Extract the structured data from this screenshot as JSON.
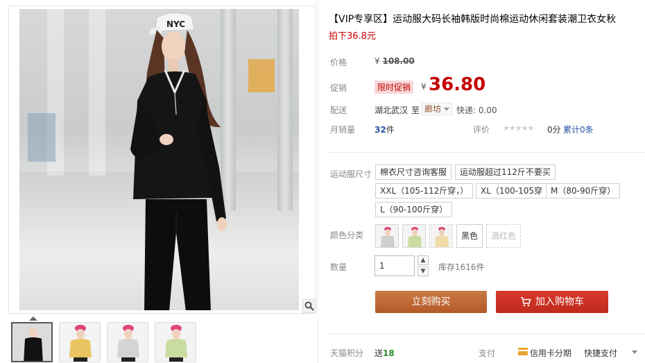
{
  "product": {
    "title": "【VIP专享区】运动服大码长袖韩版时尚棉运动休闲套装潮卫衣女秋",
    "subtitle": "拍下36.8元"
  },
  "price": {
    "label": "价格",
    "currency": "¥",
    "original": "108.00",
    "promo_label": "促销",
    "promo_tag": "限时促销",
    "promo_currency": "¥",
    "promo_value": "36.80"
  },
  "shipping": {
    "label": "配送",
    "from": "湖北武汉",
    "to_word": "至",
    "destination": "廊坊",
    "fee": "快递: 0.00"
  },
  "sales": {
    "label": "月销量",
    "count": "32",
    "unit": "件",
    "rating_label": "评价",
    "stars": "★★★★★",
    "score": "0分",
    "review_link": "累计0条"
  },
  "size": {
    "label": "运动服尺寸",
    "options": [
      "棉衣尺寸咨询客服",
      "运动服超过112斤不要买",
      "XXL（105-112斤穿，）",
      "XL（100-105穿",
      "M（80-90斤穿）",
      "L（90-100斤穿）"
    ]
  },
  "color": {
    "label": "颜色分类",
    "text_option": "黑色",
    "disabled_option": "酒红色"
  },
  "quantity": {
    "label": "数量",
    "value": "1",
    "stock": "库存1616件"
  },
  "actions": {
    "buy_now": "立刻购买",
    "add_to_cart": "加入购物车"
  },
  "footer": {
    "points_label": "天猫积分",
    "points_prefix": "送",
    "points_value": "18",
    "pay_label": "支付",
    "pay_card": "信用卡分期",
    "pay_quick": "快捷支付"
  },
  "colors": {
    "accent_red": "#c40000",
    "buy_button": "#b45a28",
    "cart_button": "#c0291d",
    "link_blue": "#2953a6"
  }
}
